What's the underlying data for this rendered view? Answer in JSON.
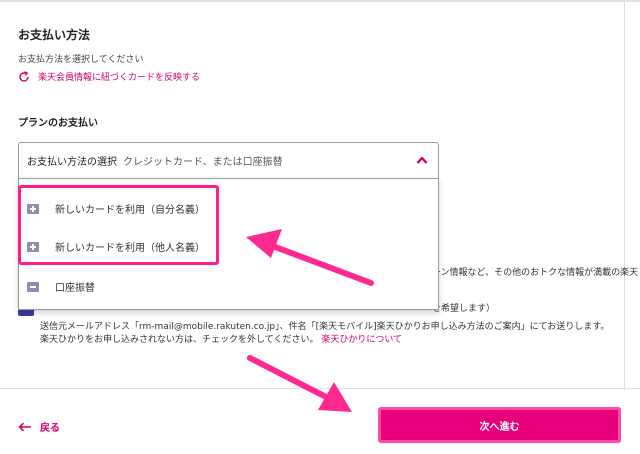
{
  "payment": {
    "title": "お支払い方法",
    "subtitle": "お支払方法を選択してください",
    "refresh_link": "楽天会員情報に紐づくカードを反映する"
  },
  "plan": {
    "title": "プランのお支払い",
    "select_label": "お支払い方法の選択",
    "select_value": "クレジットカード、または口座振替",
    "options": [
      {
        "label": "新しいカードを利用（自分名義）"
      },
      {
        "label": "新しいカードを利用（他人名義）"
      },
      {
        "label": "口座振替"
      }
    ]
  },
  "behind": {
    "line1": "ーン情報など、その他のおトクな情報が満載の楽天",
    "line2": "を希望します）"
  },
  "email_note": {
    "text": "送信元メールアドレス「rm-mail@mobile.rakuten.co.jp」、件名「[楽天モバイル]楽天ひかりお申し込み方法のご案内」にてお送りします。楽天ひかりをお申し込みされない方は、チェックを外してください。",
    "link": "楽天ひかりについて"
  },
  "footer": {
    "back_label": "戻る",
    "next_label": "次へ進む"
  },
  "colors": {
    "accent": "#d1006f",
    "button": "#e8007a",
    "highlight": "#ff1f8a",
    "checkbox": "#3a3aa8"
  }
}
